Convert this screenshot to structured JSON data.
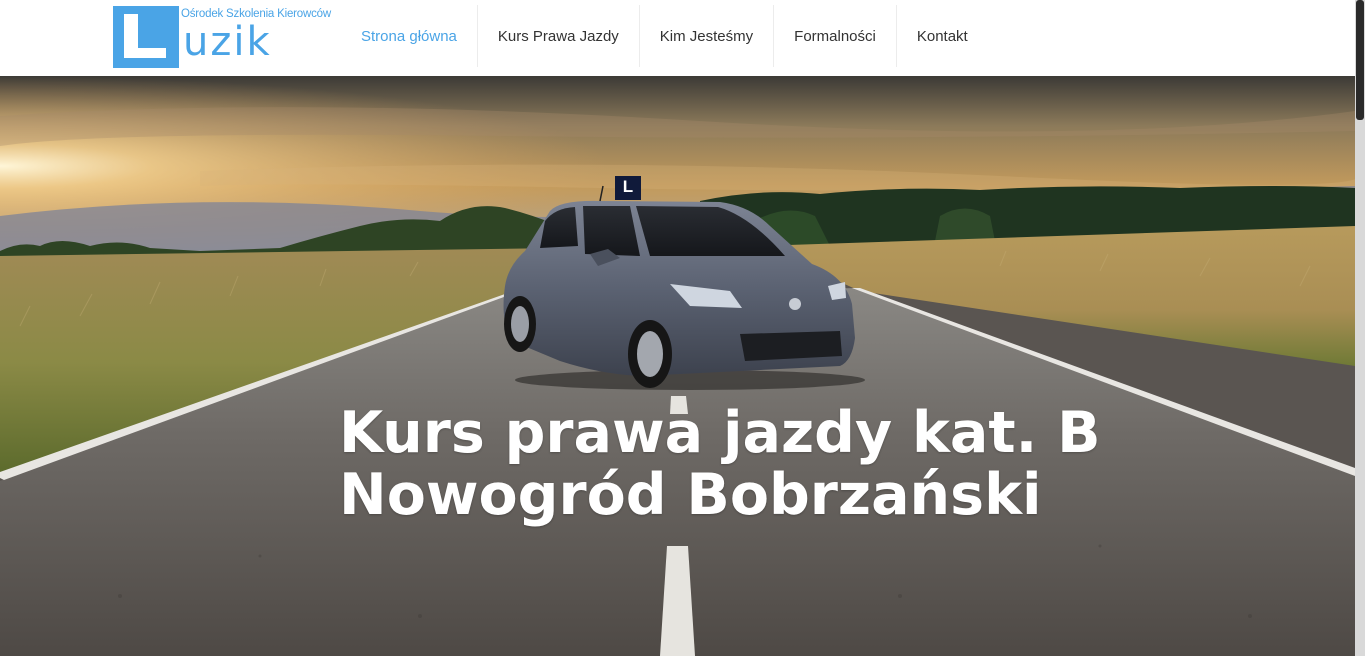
{
  "logo": {
    "letter": "L",
    "word": "uzik",
    "subtitle": "Ośrodek Szkolenia Kierowców"
  },
  "nav": {
    "items": [
      {
        "label": "Strona główna",
        "active": true
      },
      {
        "label": "Kurs Prawa Jazdy",
        "active": false
      },
      {
        "label": "Kim Jesteśmy",
        "active": false
      },
      {
        "label": "Formalności",
        "active": false
      },
      {
        "label": "Kontakt",
        "active": false
      }
    ]
  },
  "hero": {
    "headline_line1": "Kurs prawa jazdy kat. B",
    "headline_line2": "Nowogród Bobrzański",
    "roof_sign": "L"
  },
  "colors": {
    "accent": "#4aa4e6",
    "nav_text": "#333333",
    "headline": "#ffffff"
  }
}
